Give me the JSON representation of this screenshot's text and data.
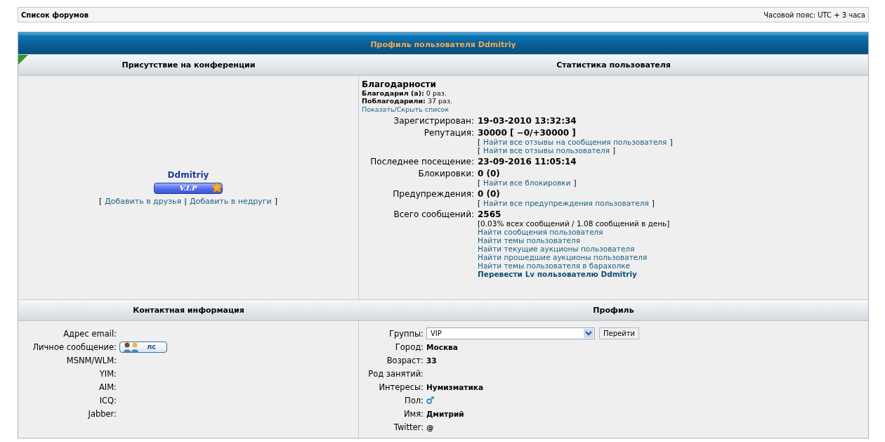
{
  "breadcrumb": {
    "link": "Список форумов",
    "timezone": "Часовой пояс: UTC + 3 часа"
  },
  "profile": {
    "title": "Профиль пользователя Ddmitriy",
    "presence": {
      "heading": "Присутствие на конференции",
      "username": "Ddmitriy",
      "rank_badge": "V.I.P",
      "actions": [
        {
          "kind": "text",
          "text": "["
        },
        {
          "kind": "link",
          "text": "Добавить в друзья"
        },
        {
          "kind": "text",
          "text": "|"
        },
        {
          "kind": "link",
          "text": "Добавить в недруги"
        },
        {
          "kind": "text",
          "text": "]"
        }
      ]
    },
    "stats": {
      "heading": "Статистика пользователя",
      "thanks": {
        "heading": "Благодарности",
        "lines": [
          {
            "label": "Благодарил (а):",
            "value": "0 раз."
          },
          {
            "label": "Поблагодарили:",
            "value": "37 раз."
          }
        ],
        "toggle": "Показать/Скрыть список"
      },
      "rows": [
        {
          "label": "Зарегистрирован:",
          "value": "19-03-2010 13:32:34",
          "lines": []
        },
        {
          "label": "Репутация:",
          "value": "30000 [ −0/+30000 ]",
          "lines": [
            {
              "kind": "bracketed",
              "open": "[",
              "text": "Найти все отзывы на сообщения пользователя",
              "close": "]"
            },
            {
              "kind": "bracketed",
              "open": "[",
              "text": "Найти все отзывы пользователя",
              "close": "]"
            }
          ]
        },
        {
          "label": "Последнее посещение:",
          "value": "23-09-2016 11:05:14",
          "lines": []
        },
        {
          "label": "Блокировки:",
          "value": "0 (0)",
          "lines": [
            {
              "kind": "bracketed",
              "open": "[",
              "text": "Найти все блокировки",
              "close": "]"
            }
          ]
        },
        {
          "label": "Предупреждения:",
          "value": "0 (0)",
          "lines": [
            {
              "kind": "bracketed",
              "open": "[",
              "text": "Найти все предупреждения пользователя",
              "close": "]"
            }
          ]
        },
        {
          "label": "Всего сообщений:",
          "value": "2565",
          "lines": [
            {
              "kind": "text",
              "text": "[0.03% всех сообщений / 1.08 сообщений в день]"
            },
            {
              "kind": "link",
              "text": "Найти сообщения пользователя"
            },
            {
              "kind": "link",
              "text": "Найти темы пользователя"
            },
            {
              "kind": "link",
              "text": "Найти текущие аукционы пользователя"
            },
            {
              "kind": "link",
              "text": "Найти прошедшие аукционы пользователя"
            },
            {
              "kind": "link",
              "text": "Найти темы пользователя в барахолке"
            },
            {
              "kind": "strong_link",
              "text": "Перевести Lv пользователю Ddmitriy"
            }
          ]
        }
      ]
    },
    "contact": {
      "heading": "Контактная информация",
      "rows": [
        {
          "kind": "text",
          "label": "Адрес email:"
        },
        {
          "kind": "pm_button",
          "label": "Личное сообщение:",
          "value": "лс"
        },
        {
          "kind": "text",
          "label": "MSNM/WLM:"
        },
        {
          "kind": "text",
          "label": "YIM:"
        },
        {
          "kind": "text",
          "label": "AIM:"
        },
        {
          "kind": "text",
          "label": "ICQ:"
        },
        {
          "kind": "text",
          "label": "Jabber:"
        }
      ]
    },
    "details": {
      "heading": "Профиль",
      "rows": [
        {
          "kind": "select",
          "label": "Группы:",
          "value": "VIP",
          "button": "Перейти"
        },
        {
          "kind": "text",
          "label": "Город:",
          "value": "Москва"
        },
        {
          "kind": "text",
          "label": "Возраст:",
          "value": "33"
        },
        {
          "kind": "text",
          "label": "Род занятий:"
        },
        {
          "kind": "text",
          "label": "Интересы:",
          "value": "Нумизматика"
        },
        {
          "kind": "gender",
          "label": "Пол:"
        },
        {
          "kind": "text",
          "label": "Имя:",
          "value": "Дмитрий"
        },
        {
          "kind": "text",
          "label": "Twitter:",
          "value": "@"
        }
      ]
    }
  }
}
